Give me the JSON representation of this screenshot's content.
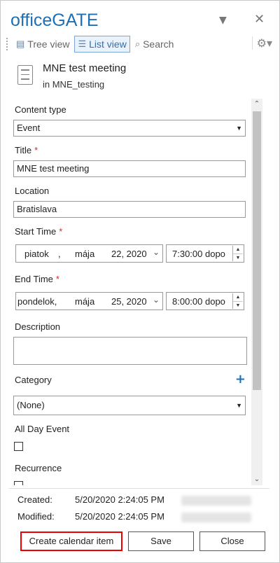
{
  "header": {
    "title": "officeGATE",
    "menu_icon": "chevron-down-icon",
    "close_icon": "close-icon"
  },
  "toolbar": {
    "tree_view": "Tree view",
    "list_view": "List view",
    "search": "Search",
    "settings_icon": "gear-icon"
  },
  "item": {
    "title": "MNE test meeting",
    "location_path": "in MNE_testing"
  },
  "form": {
    "content_type_label": "Content type",
    "content_type_value": "Event",
    "title_label": "Title",
    "title_value": "MNE test meeting",
    "location_label": "Location",
    "location_value": "Bratislava",
    "start_time_label": "Start Time",
    "start_day": "piatok",
    "start_comma": ",",
    "start_month": "mája",
    "start_date": "22, 2020",
    "start_time": "7:30:00 dopo",
    "end_time_label": "End Time",
    "end_day": "pondelok,",
    "end_month": "mája",
    "end_date": "25, 2020",
    "end_time": "8:00:00 dopo",
    "description_label": "Description",
    "description_value": "",
    "category_label": "Category",
    "category_value": "(None)",
    "all_day_label": "All Day Event",
    "recurrence_label": "Recurrence",
    "required_mark": "*",
    "add_mark": "+"
  },
  "meta": {
    "created_label": "Created:",
    "created_value": "5/20/2020 2:24:05 PM",
    "modified_label": "Modified:",
    "modified_value": "5/20/2020 2:24:05 PM"
  },
  "buttons": {
    "create": "Create calendar item",
    "save": "Save",
    "close": "Close"
  },
  "colors": {
    "brand": "#1f6fb5",
    "required": "#d03030",
    "highlight": "#e00000"
  }
}
